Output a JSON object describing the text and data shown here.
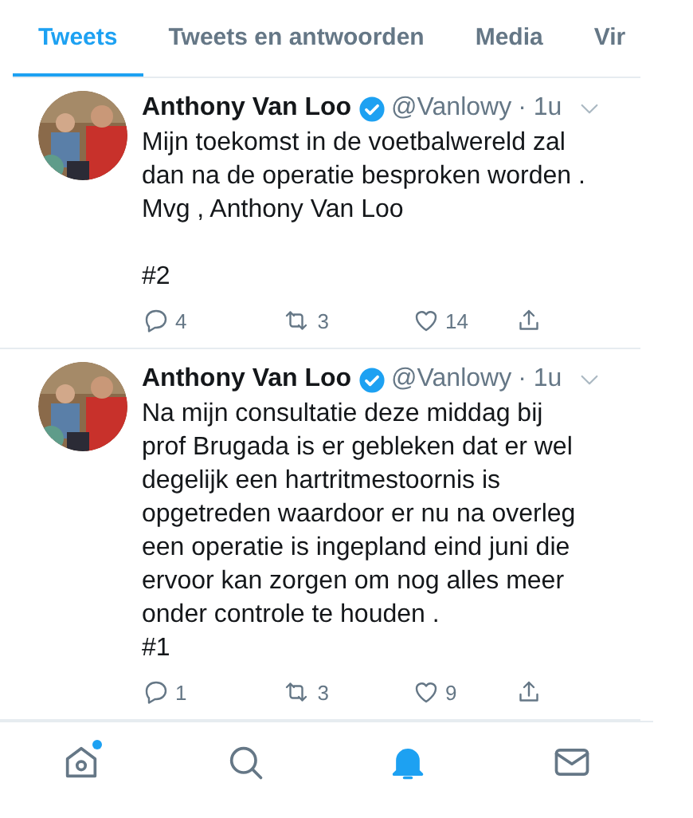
{
  "tabs": [
    {
      "label": "Tweets",
      "selected": true
    },
    {
      "label": "Tweets en antwoorden",
      "selected": false
    },
    {
      "label": "Media",
      "selected": false
    },
    {
      "label": "Vir",
      "selected": false
    }
  ],
  "tweets": [
    {
      "name": "Anthony Van Loo",
      "verified": true,
      "handle": "@Vanlowy",
      "time": "· 1u",
      "text": "Mijn toekomst in de voetbalwereld zal\ndan na de operatie besproken worden .\nMvg , Anthony Van Loo\n\n#2",
      "replies": "4",
      "retweets": "3",
      "likes": "14"
    },
    {
      "name": "Anthony Van Loo",
      "verified": true,
      "handle": "@Vanlowy",
      "time": "· 1u",
      "text": "Na mijn consultatie deze middag bij\nprof Brugada is er gebleken dat er wel\ndegelijk een hartritmestoornis is\nopgetreden waardoor er nu na overleg\neen operatie is ingepland eind juni die\nervoor kan zorgen om nog alles meer\nonder controle te houden .\n#1",
      "replies": "1",
      "retweets": "3",
      "likes": "9"
    }
  ],
  "nav": [
    {
      "kind": "home",
      "selected": false,
      "unread": true
    },
    {
      "kind": "search",
      "selected": false,
      "unread": false
    },
    {
      "kind": "notifications",
      "selected": true,
      "unread": false
    },
    {
      "kind": "messages",
      "selected": false,
      "unread": false
    }
  ]
}
